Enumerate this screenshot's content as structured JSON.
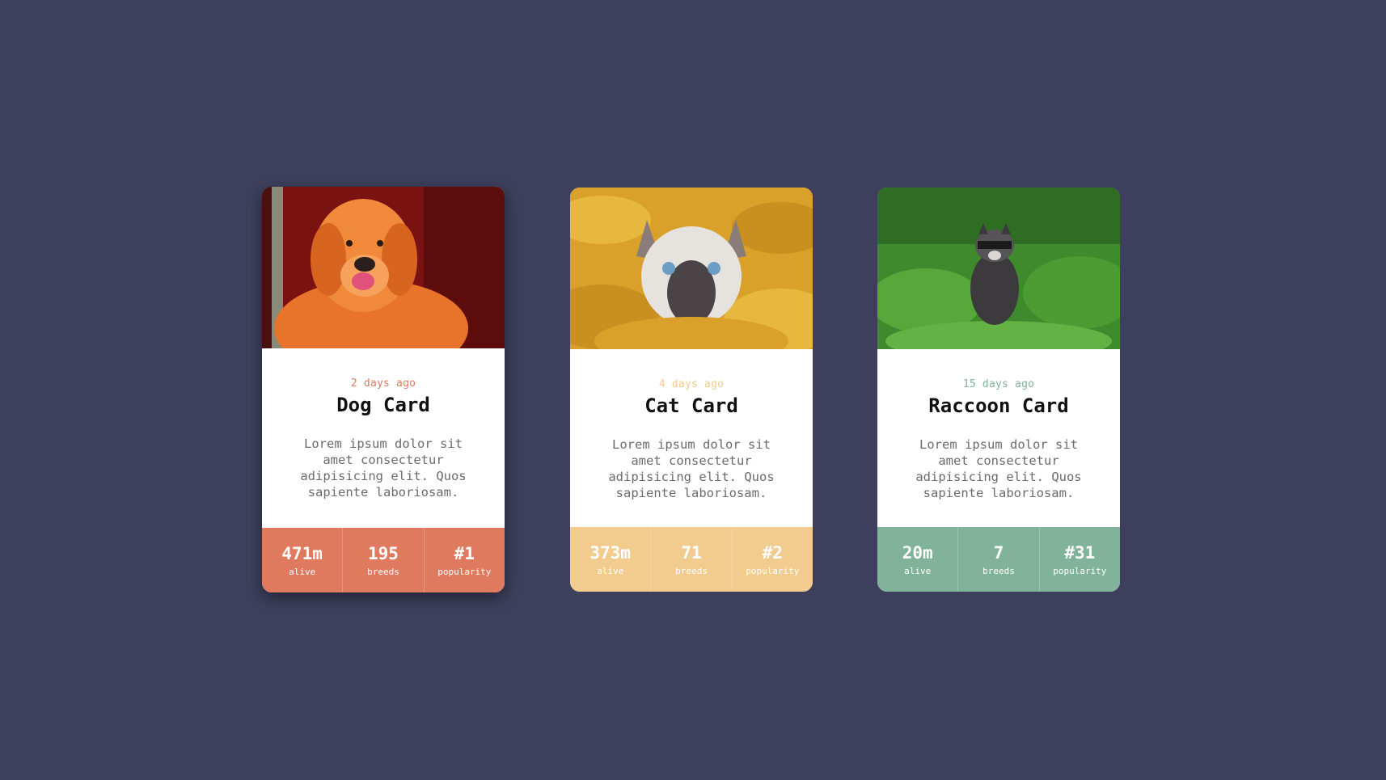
{
  "cards": [
    {
      "date": "2 days ago",
      "title": "Dog Card",
      "description": "Lorem ipsum dolor sit amet consectetur adipisicing elit. Quos sapiente laboriosam.",
      "accent": "#e07a5f",
      "stats": [
        {
          "value": "471m",
          "label": "alive"
        },
        {
          "value": "195",
          "label": "breeds"
        },
        {
          "value": "#1",
          "label": "popularity"
        }
      ]
    },
    {
      "date": "4 days ago",
      "title": "Cat Card",
      "description": "Lorem ipsum dolor sit amet consectetur adipisicing elit. Quos sapiente laboriosam.",
      "accent": "#f2cc8f",
      "stats": [
        {
          "value": "373m",
          "label": "alive"
        },
        {
          "value": "71",
          "label": "breeds"
        },
        {
          "value": "#2",
          "label": "popularity"
        }
      ]
    },
    {
      "date": "15 days ago",
      "title": "Raccoon Card",
      "description": "Lorem ipsum dolor sit amet consectetur adipisicing elit. Quos sapiente laboriosam.",
      "accent": "#81b29a",
      "stats": [
        {
          "value": "20m",
          "label": "alive"
        },
        {
          "value": "7",
          "label": "breeds"
        },
        {
          "value": "#31",
          "label": "popularity"
        }
      ]
    }
  ]
}
